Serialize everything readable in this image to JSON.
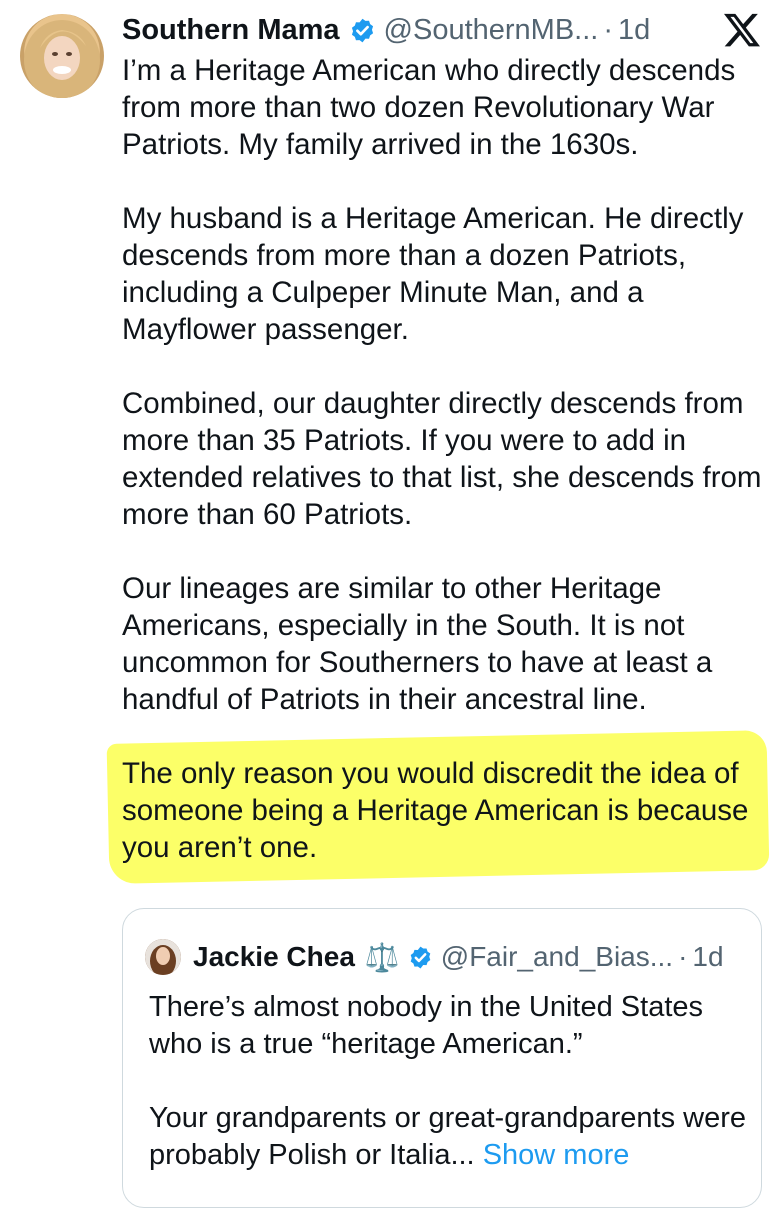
{
  "author": {
    "name": "Southern Mama",
    "handle": "@SouthernMB...",
    "separator": "·",
    "time": "1d"
  },
  "icons": {
    "avatar": "profile-photo",
    "verified": "verified-badge-icon",
    "logo": "x-logo-icon",
    "scales": "scales-emoji"
  },
  "colors": {
    "verified_blue": "#1d9bf0",
    "highlight_yellow": "#fbff3d",
    "secondary_text": "#536471",
    "link_blue": "#1d9bf0"
  },
  "tweet": {
    "paragraphs": [
      "I’m a Heritage American who directly descends from more than two dozen Revolutionary War Patriots. My family arrived in the 1630s.",
      "My husband is a Heritage American. He directly descends from more than a dozen Patriots, including a Culpeper Minute Man, and a Mayflower passenger.",
      "Combined, our daughter directly descends from more than 35 Patriots. If you were to add in extended relatives to that list, she descends from more than 60 Patriots.",
      "Our lineages are similar to other Heritage Americans, especially in the South. It is not uncommon for Southerners to have at least a handful of Patriots in their ancestral line."
    ],
    "highlighted": "The only reason you would discredit the idea of someone being a Heritage American is because you aren’t one."
  },
  "quote": {
    "name": "Jackie Chea",
    "emoji": "⚖️",
    "handle": "@Fair_and_Bias...",
    "separator": "·",
    "time": "1d",
    "paragraph1": "There’s almost nobody in the United States who is a true “heritage American.”",
    "paragraph2": "Your grandparents or great-grandparents were probably Polish or Italia...",
    "show_more": "Show more"
  }
}
